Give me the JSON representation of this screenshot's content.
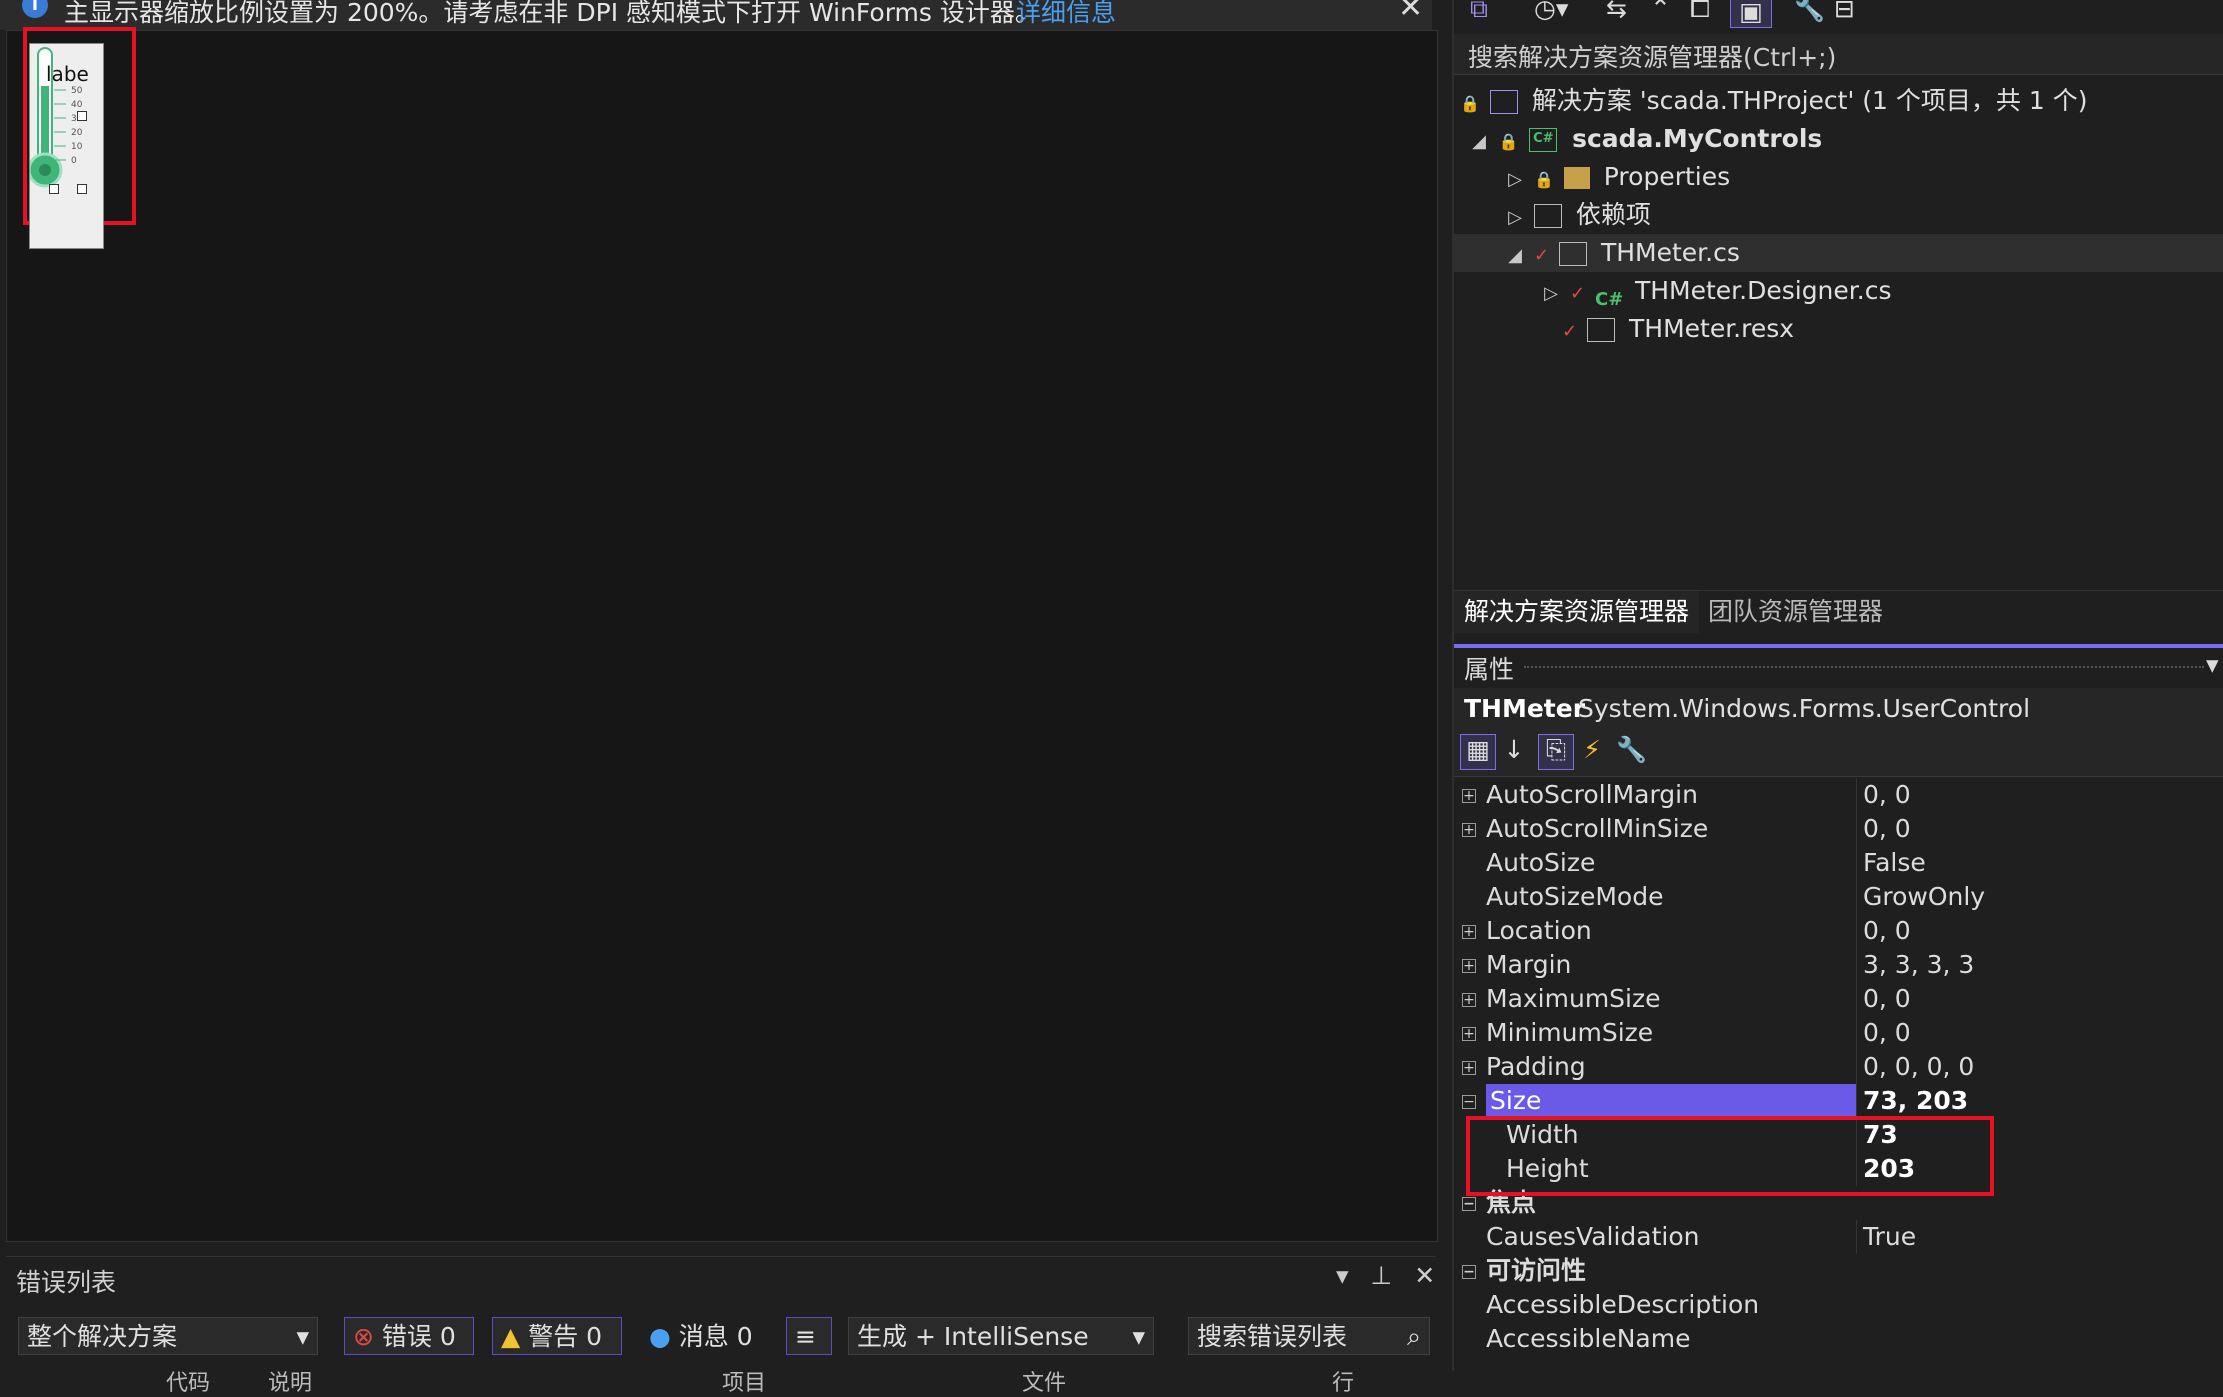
{
  "infobar": {
    "message": "主显示器缩放比例设置为 200%。请考虑在非 DPI 感知模式下打开 WinForms 设计器。",
    "link": "详细信息"
  },
  "designer": {
    "control_label": "labe",
    "scale_ticks": [
      "50",
      "40",
      "30",
      "20",
      "10",
      "0"
    ]
  },
  "solution_explorer": {
    "search_placeholder": "搜索解决方案资源管理器(Ctrl+;)",
    "items": [
      {
        "label": "解决方案 'scada.THProject' (1 个项目，共 1 个)"
      },
      {
        "label": "scada.MyControls"
      },
      {
        "label": "Properties"
      },
      {
        "label": "依赖项"
      },
      {
        "label": "THMeter.cs"
      },
      {
        "label": "THMeter.Designer.cs"
      },
      {
        "label": "THMeter.resx"
      }
    ],
    "tabs": [
      "解决方案资源管理器",
      "团队资源管理器"
    ]
  },
  "properties": {
    "title": "属性",
    "object_name": "THMeter",
    "object_type": "System.Windows.Forms.UserControl",
    "rows": [
      {
        "name": "AutoScrollMargin",
        "value": "0, 0"
      },
      {
        "name": "AutoScrollMinSize",
        "value": "0, 0"
      },
      {
        "name": "AutoSize",
        "value": "False"
      },
      {
        "name": "AutoSizeMode",
        "value": "GrowOnly"
      },
      {
        "name": "Location",
        "value": "0, 0"
      },
      {
        "name": "Margin",
        "value": "3, 3, 3, 3"
      },
      {
        "name": "MaximumSize",
        "value": "0, 0"
      },
      {
        "name": "MinimumSize",
        "value": "0, 0"
      },
      {
        "name": "Padding",
        "value": "0, 0, 0, 0"
      },
      {
        "name": "Size",
        "value": "73, 203"
      },
      {
        "name": "Width",
        "value": "73"
      },
      {
        "name": "Height",
        "value": "203"
      },
      {
        "name": "焦点",
        "value": ""
      },
      {
        "name": "CausesValidation",
        "value": "True"
      },
      {
        "name": "可访问性",
        "value": ""
      },
      {
        "name": "AccessibleDescription",
        "value": ""
      },
      {
        "name": "AccessibleName",
        "value": ""
      }
    ]
  },
  "error_list": {
    "title": "错误列表",
    "scope": "整个解决方案",
    "errors": "错误 0",
    "warnings": "警告 0",
    "messages": "消息 0",
    "build_filter": "生成 + IntelliSense",
    "search_placeholder": "搜索错误列表",
    "columns": [
      "代码",
      "说明",
      "项目",
      "文件",
      "行"
    ]
  },
  "colors": {
    "accent": "#6b5ae8",
    "highlight_box": "#e81123",
    "thermo_green": "#3fb57a"
  }
}
